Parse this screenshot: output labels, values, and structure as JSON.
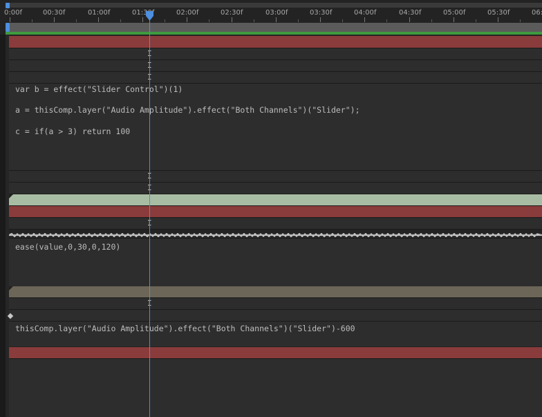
{
  "timeline": {
    "ruler_labels": [
      "0:00f",
      "00:30f",
      "01:00f",
      "01:30f",
      "02:00f",
      "02:30f",
      "03:00f",
      "03:30f",
      "04:00f",
      "04:30f",
      "05:00f",
      "05:30f",
      "06:"
    ],
    "accent_color": "#4d8fe0",
    "work_area_color": "#3e9a3e"
  },
  "expressions": {
    "slider_line_1": "var b = effect(\"Slider Control\")(1)",
    "slider_line_2": "a = thisComp.layer(\"Audio Amplitude\").effect(\"Both Channels\")(\"Slider\");",
    "slider_line_3": "c = if(a > 3) return 100",
    "ease_line": "ease(value,0,30,0,120)",
    "position_line": "thisComp.layer(\"Audio Amplitude\").effect(\"Both Channels\")(\"Slider\")-600"
  },
  "layer_colors": {
    "red": "#8a3b3b",
    "sage": "#a8bca4",
    "tan": "#6b6657"
  },
  "icons": {
    "playhead": "playhead-marker-icon",
    "text_cursor": "ibeam-cursor-icon",
    "keyframe": "keyframe-diamond-icon"
  }
}
